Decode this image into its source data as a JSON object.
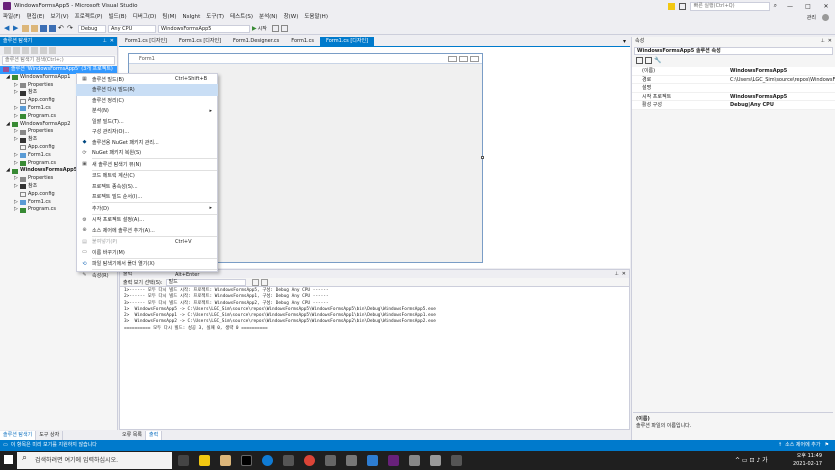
{
  "window": {
    "title": "WindowsFormsApp5 - Microsoft Visual Studio",
    "quick_launch": "빠른 실행(Ctrl+Q)",
    "user": "관리"
  },
  "menu": [
    "파일(F)",
    "편집(E)",
    "보기(V)",
    "프로젝트(P)",
    "빌드(B)",
    "디버그(D)",
    "팀(M)",
    "NsIght",
    "도구(T)",
    "테스트(S)",
    "분석(N)",
    "창(W)",
    "도움말(H)"
  ],
  "toolbar": {
    "config": "Debug",
    "platform": "Any CPU",
    "project": "WindowsFormsApp5",
    "start": "시작"
  },
  "solution_explorer": {
    "title": "솔루션 탐색기",
    "search_placeholder": "솔루션 탐색기 검색(Ctrl+;)",
    "root": "솔루션 'WindowsFormsApp5' (3개 프로젝트)",
    "projects": [
      {
        "name": "WindowsFormsApp1",
        "items": [
          "Properties",
          "참조",
          "App.config",
          "Form1.cs",
          "Program.cs"
        ]
      },
      {
        "name": "WindowsFormsApp2",
        "items": [
          "Properties",
          "참조",
          "App.config",
          "Form1.cs",
          "Program.cs"
        ]
      },
      {
        "name": "WindowsFormsApp5",
        "items": [
          "Properties",
          "참조",
          "App.config",
          "Form1.cs",
          "Program.cs"
        ]
      }
    ],
    "bottom_tabs": [
      "솔루션 탐색기",
      "도구 상자"
    ]
  },
  "doc_tabs": [
    "Form1.cs [디자인]",
    "Form1.cs [디자인]",
    "Form1.Designer.cs",
    "Form1.cs",
    "Form1.cs [디자인]"
  ],
  "form_designer": {
    "title": "Form1"
  },
  "context_menu": [
    {
      "label": "솔루션 빌드(B)",
      "shortcut": "Ctrl+Shift+B",
      "icon": "build-icon"
    },
    {
      "label": "솔루션 다시 빌드(R)",
      "shortcut": "",
      "hover": true
    },
    {
      "label": "솔루션 정리(C)",
      "shortcut": ""
    },
    {
      "label": "분석(N)",
      "shortcut": "",
      "submenu": true
    },
    {
      "label": "일괄 빌드(T)...",
      "shortcut": ""
    },
    {
      "label": "구성 관리자(O)...",
      "shortcut": ""
    },
    {
      "label": "솔루션용 NuGet 패키지 관리...",
      "shortcut": "",
      "icon": "nuget-icon"
    },
    {
      "label": "NuGet 패키지 복원(S)",
      "shortcut": "",
      "icon": "restore-icon"
    },
    {
      "label": "새 솔루션 탐색기 뷰(N)",
      "shortcut": "",
      "icon": "new-view-icon"
    },
    {
      "label": "코드 메트릭 계산(C)",
      "shortcut": ""
    },
    {
      "label": "프로젝트 종속성(S)...",
      "shortcut": ""
    },
    {
      "label": "프로젝트 빌드 순서(I)...",
      "shortcut": ""
    },
    {
      "label": "추가(D)",
      "shortcut": "",
      "submenu": true
    },
    {
      "label": "시작 프로젝트 설정(A)...",
      "shortcut": "",
      "icon": "gear-icon"
    },
    {
      "label": "소스 제어에 솔루션 추가(A)...",
      "shortcut": "",
      "icon": "source-control-icon"
    },
    {
      "label": "붙여넣기(P)",
      "shortcut": "Ctrl+V",
      "disabled": true,
      "icon": "paste-icon"
    },
    {
      "label": "이름 바꾸기(M)",
      "shortcut": "",
      "icon": "rename-icon"
    },
    {
      "label": "파일 탐색기에서 폴더 열기(X)",
      "shortcut": "",
      "icon": "folder-icon"
    },
    {
      "label": "속성(R)",
      "shortcut": "Alt+Enter",
      "icon": "wrench-icon"
    }
  ],
  "output": {
    "title": "출력",
    "source_label": "출력 보기 선택(S):",
    "source_value": "빌드",
    "lines": [
      "1>------ 모두 다시 빌드 시작: 프로젝트: WindowsFormsApp5, 구성: Debug Any CPU ------",
      "2>------ 모두 다시 빌드 시작: 프로젝트: WindowsFormsApp1, 구성: Debug Any CPU ------",
      "3>------ 모두 다시 빌드 시작: 프로젝트: WindowsFormsApp2, 구성: Debug Any CPU ------",
      "1>  WindowsFormsApp5 -> C:\\Users\\LGC_Sim\\source\\repos\\WindowsFormsApp5\\WindowsFormsApp5\\bin\\Debug\\WindowsFormsApp5.exe",
      "2>  WindowsFormsApp1 -> C:\\Users\\LGC_Sim\\source\\repos\\WindowsFormsApp5\\WindowsFormsApp1\\bin\\Debug\\WindowsFormsApp1.exe",
      "3>  WindowsFormsApp2 -> C:\\Users\\LGC_Sim\\source\\repos\\WindowsFormsApp5\\WindowsFormsApp2\\bin\\Debug\\WindowsFormsApp2.exe",
      "========== 모두 다시 빌드: 성공 3, 실패 0, 생략 0 =========="
    ],
    "tabs": [
      "오류 목록",
      "출력"
    ]
  },
  "properties": {
    "title": "속성",
    "object": "WindowsFormsApp5 솔루션 속성",
    "rows": [
      {
        "key": "(이름)",
        "value": "WindowsFormsApp5"
      },
      {
        "key": "경로",
        "value": "C:\\Users\\LGC_Sim\\source\\repos\\WindowsFormsApp5\\Win"
      },
      {
        "key": "설명",
        "value": ""
      },
      {
        "key": "시작 프로젝트",
        "value": "WindowsFormsApp5"
      },
      {
        "key": "활성 구성",
        "value": "Debug|Any CPU"
      }
    ],
    "desc_title": "(이름)",
    "desc_text": "솔루션 파일의 이름입니다."
  },
  "statusbar": {
    "left": "이 항목은 미리 보기를 지원하지 않습니다",
    "right": "소스 제어에 추가"
  },
  "taskbar": {
    "search": "검색하려면 여기에 입력하십시오.",
    "time": "오후 11:49",
    "date": "2021-02-17"
  },
  "colors": {
    "accent": "#007acc",
    "selection": "#3399ff",
    "menu_hover": "#c9def5"
  }
}
